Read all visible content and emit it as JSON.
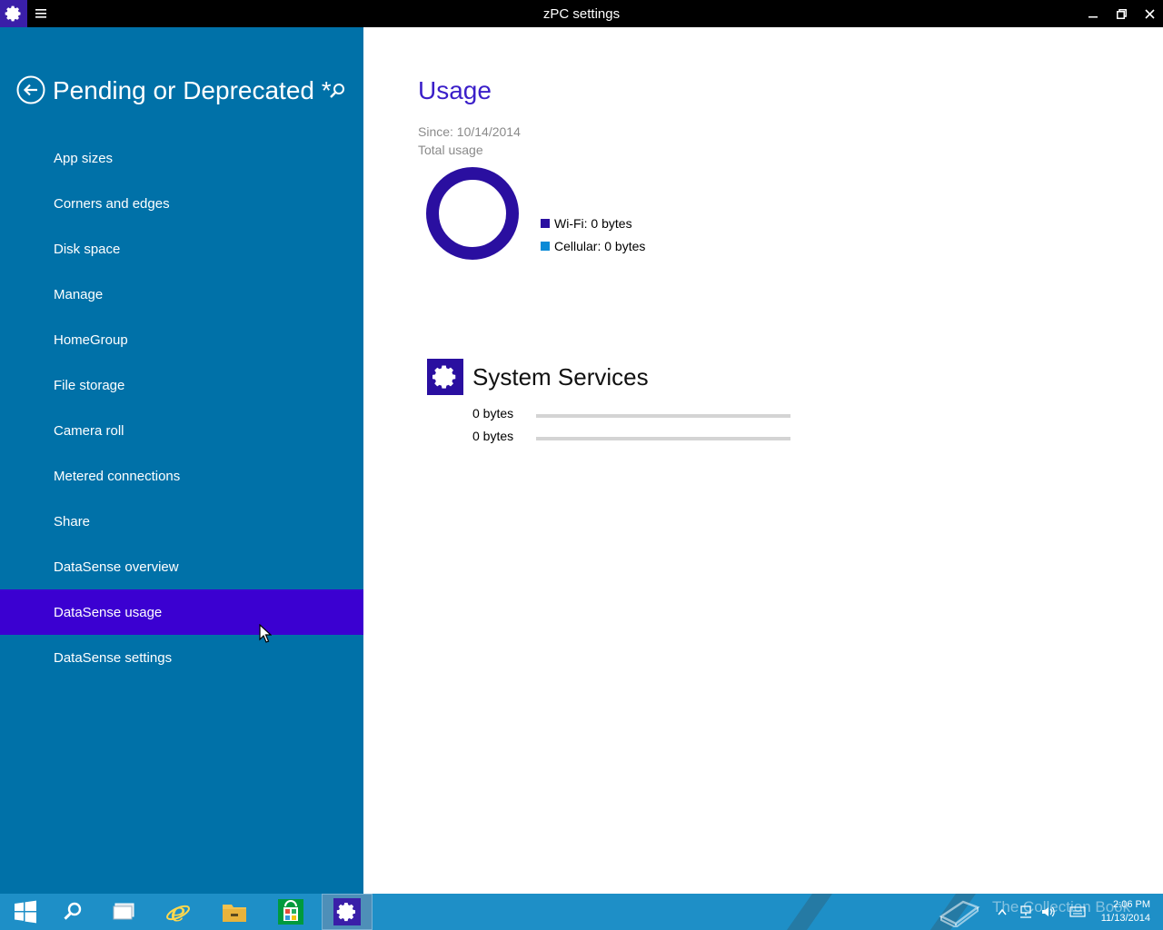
{
  "window": {
    "title": "zPC settings"
  },
  "left_pane": {
    "title": "Pending or Deprecated *",
    "items": [
      {
        "label": "App sizes",
        "selected": false
      },
      {
        "label": "Corners and edges",
        "selected": false
      },
      {
        "label": "Disk space",
        "selected": false
      },
      {
        "label": "Manage",
        "selected": false
      },
      {
        "label": "HomeGroup",
        "selected": false
      },
      {
        "label": "File storage",
        "selected": false
      },
      {
        "label": "Camera roll",
        "selected": false
      },
      {
        "label": "Metered connections",
        "selected": false
      },
      {
        "label": "Share",
        "selected": false
      },
      {
        "label": "DataSense overview",
        "selected": false
      },
      {
        "label": "DataSense usage",
        "selected": true
      },
      {
        "label": "DataSense settings",
        "selected": false
      }
    ]
  },
  "usage": {
    "title": "Usage",
    "since": "Since: 10/14/2014",
    "total_label": "Total usage",
    "legend": [
      {
        "label": "Wi-Fi: 0 bytes",
        "color": "#2a0fa0"
      },
      {
        "label": "Cellular: 0 bytes",
        "color": "#0a8ad6"
      }
    ]
  },
  "services": {
    "title": "System Services",
    "rows": [
      {
        "value": "0 bytes",
        "fill": 0
      },
      {
        "value": "0 bytes",
        "fill": 0
      }
    ]
  },
  "taskbar": {
    "watermark": "The Collection Book",
    "time": "2:06 PM",
    "date": "11/13/2014"
  },
  "colors": {
    "accent": "#3b00d1",
    "pane": "#0071a8",
    "taskbar": "#1e8fc7"
  }
}
